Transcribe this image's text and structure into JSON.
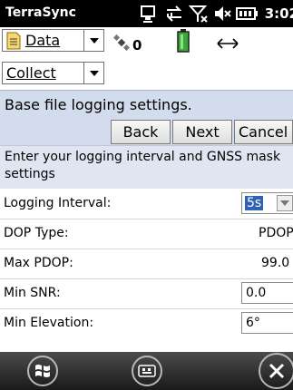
{
  "status_bar": {
    "app_title": "TerraSync",
    "clock": "3:02"
  },
  "toolbar": {
    "section_dropdown": "Data",
    "satellite_count": "0",
    "mode_dropdown": "Collect"
  },
  "header": {
    "title": "Base file logging settings.",
    "back_label": "Back",
    "next_label": "Next",
    "cancel_label": "Cancel"
  },
  "instructions": {
    "line1": "Enter your logging interval and GNSS mask",
    "line2": "settings"
  },
  "settings": {
    "logging_interval_label": "Logging Interval:",
    "logging_interval_value": "5s",
    "dop_type_label": "DOP Type:",
    "dop_type_value": "PDOP",
    "max_pdop_label": "Max PDOP:",
    "max_pdop_value": "99.0",
    "min_snr_label": "Min SNR:",
    "min_snr_value": "0.0",
    "min_elevation_label": "Min Elevation:",
    "min_elevation_value": "6°"
  },
  "colors": {
    "header_bg": "#d3dcec",
    "selection": "#2f62b3"
  }
}
